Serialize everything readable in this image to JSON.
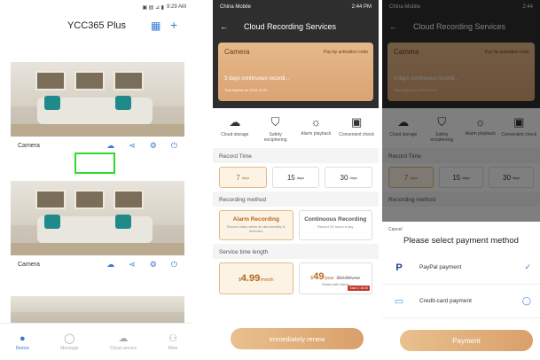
{
  "panel1": {
    "status_time": "9:29 AM",
    "title": "YCC365 Plus",
    "cameras": [
      {
        "name": "Camera"
      },
      {
        "name": "Camera"
      }
    ],
    "tabs": [
      {
        "label": "Device",
        "icon": "device-icon"
      },
      {
        "label": "Message",
        "icon": "message-icon"
      },
      {
        "label": "Cloud service",
        "icon": "cloud-icon"
      },
      {
        "label": "Mine",
        "icon": "user-icon"
      }
    ]
  },
  "panel2": {
    "carrier": "China Mobile",
    "status_time": "2:44 PM",
    "header_title": "Cloud Recording Services",
    "card": {
      "title": "Camera",
      "pay_link": "Pay by activation code",
      "plan": "3 days continuous recordi...",
      "expiry": "Trial expires on 2019-11-01"
    },
    "features": [
      {
        "label": "Cloud storage",
        "icon": "cloud-storage-icon"
      },
      {
        "label": "Safety enciphering",
        "icon": "shield-icon"
      },
      {
        "label": "Alarm playback",
        "icon": "alarm-icon"
      },
      {
        "label": "Convenient check",
        "icon": "phone-check-icon"
      }
    ],
    "record_time_label": "Record Time",
    "record_times": [
      {
        "value": "7",
        "unit": "days"
      },
      {
        "value": "15",
        "unit": "days"
      },
      {
        "value": "30",
        "unit": "days"
      }
    ],
    "method_label": "Recording method",
    "methods": [
      {
        "name": "Alarm Recording",
        "desc": "Record video when an abnormality is detected"
      },
      {
        "name": "Continuous Recording",
        "desc": "Record 24 hours a day"
      }
    ],
    "service_label": "Service time length",
    "prices": [
      {
        "currency": "$",
        "amount": "4.99",
        "period": "/month",
        "note": ""
      },
      {
        "currency": "$",
        "amount": "49",
        "period": "/year",
        "strike": "$59.88/year",
        "note": "Works with Alexa",
        "badge": "Save 2 15.00"
      }
    ],
    "renew_label": "Immediately renew"
  },
  "panel3": {
    "carrier": "China Mobile",
    "status_time": "2:44",
    "header_title": "Cloud Recording Services",
    "card_title": "Camera",
    "card_pay_link": "Pay by activation code",
    "card_plan": "3 days continuous recordi...",
    "card_expiry": "Trial expires on 2019-11-01",
    "features": [
      {
        "label": "Cloud storage"
      },
      {
        "label": "Safety enciphering"
      },
      {
        "label": "Alarm playback"
      },
      {
        "label": "Convenient check"
      }
    ],
    "record_time_label": "Record Time",
    "record_times": [
      {
        "value": "7",
        "unit": "days"
      },
      {
        "value": "15",
        "unit": "days"
      },
      {
        "value": "30",
        "unit": "days"
      }
    ],
    "method_label": "Recording method",
    "sheet": {
      "cancel": "Cancel",
      "title": "Please select payment method",
      "options": [
        {
          "label": "PayPal payment",
          "icon": "paypal-icon",
          "checked": "✓"
        },
        {
          "label": "Credit-card payment",
          "icon": "credit-card-icon",
          "checked": "◯"
        }
      ],
      "pay_label": "Payment"
    }
  },
  "colors": {
    "accent": "#3a7bd5",
    "highlight": "#2cdc28",
    "gold": "#dba373",
    "header_dark": "#2e2e2e"
  }
}
